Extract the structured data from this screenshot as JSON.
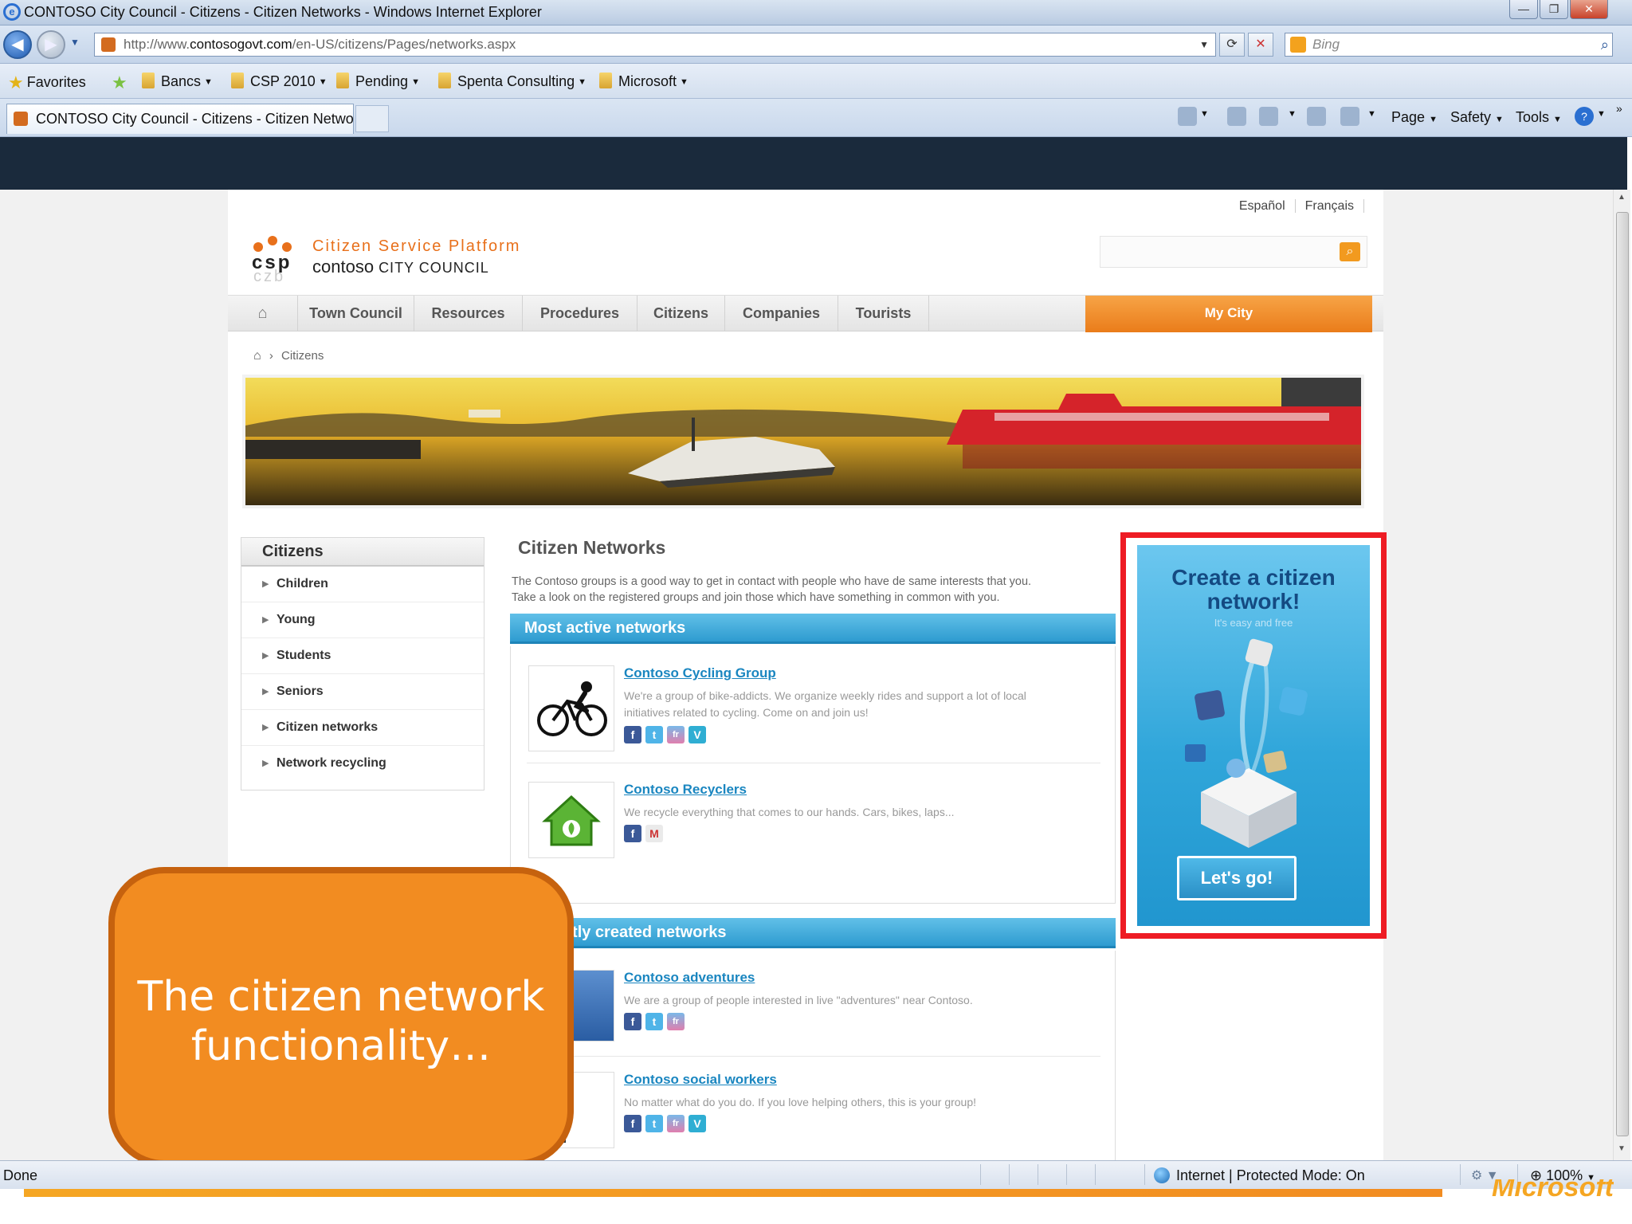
{
  "window": {
    "title": "CONTOSO City Council - Citizens - Citizen Networks - Windows Internet Explorer",
    "controls": {
      "minimize": "—",
      "maximize": "❐",
      "close": "✕"
    }
  },
  "address_bar": {
    "url_prefix": "http://www.",
    "url_domain": "contosogovt.com",
    "url_path": "/en-US/citizens/Pages/networks.aspx",
    "search_placeholder": "Bing"
  },
  "favorites_bar": {
    "favorites_label": "Favorites",
    "folders": [
      "Bancs",
      "CSP 2010",
      "Pending",
      "Spenta Consulting",
      "Microsoft"
    ]
  },
  "tab": {
    "title": "CONTOSO City Council - Citizens - Citizen Netwo..."
  },
  "command_bar": {
    "page": "Page",
    "safety": "Safety",
    "tools": "Tools"
  },
  "site": {
    "languages": [
      "Español",
      "Français"
    ],
    "platform_name": "Citizen Service Platform",
    "brand": "contoso",
    "brand_suffix": "CITY COUNCIL",
    "logo_letters": "csp",
    "logo_sub": "czb",
    "nav": [
      "Town Council",
      "Resources",
      "Procedures",
      "Citizens",
      "Companies",
      "Tourists"
    ],
    "my_city": "My City",
    "breadcrumb": "Citizens"
  },
  "left_menu": {
    "heading": "Citizens",
    "items": [
      "Children",
      "Young",
      "Students",
      "Seniors",
      "Citizen networks",
      "Network recycling"
    ]
  },
  "content": {
    "heading": "Citizen Networks",
    "intro_line1": "The Contoso groups is a good way to get in contact with people who have de same interests that you.",
    "intro_line2": "Take a look on the registered groups and join those which have something in common with you.",
    "most_active_label": "Most active networks",
    "recent_label": "Recently created networks",
    "most_active": [
      {
        "title": "Contoso Cycling Group",
        "desc": "We're a group of bike-addicts. We organize weekly rides and support a lot of local initiatives related to cycling. Come on and join us!"
      },
      {
        "title": "Contoso Recyclers",
        "desc": "We recycle everything that comes to our hands. Cars, bikes, laps..."
      }
    ],
    "recent": [
      {
        "title": "Contoso adventures",
        "desc": "We are a group of people interested in live \"adventures\" near Contoso."
      },
      {
        "title": "Contoso social workers",
        "desc": "No matter what do you do. If you love helping others, this is your group!"
      }
    ]
  },
  "promo": {
    "title_line1": "Create a citizen",
    "title_line2": "network!",
    "subtitle": "It's easy and free",
    "button": "Let's go!",
    "highlight_color": "#ee1c24"
  },
  "callout": {
    "line1": "The citizen network",
    "line2": "functionality…",
    "color": "#f28c21"
  },
  "status_bar": {
    "left": "Done",
    "zone": "Internet | Protected Mode: On",
    "zoom": "100%"
  },
  "footer_logo": "Microsoft"
}
